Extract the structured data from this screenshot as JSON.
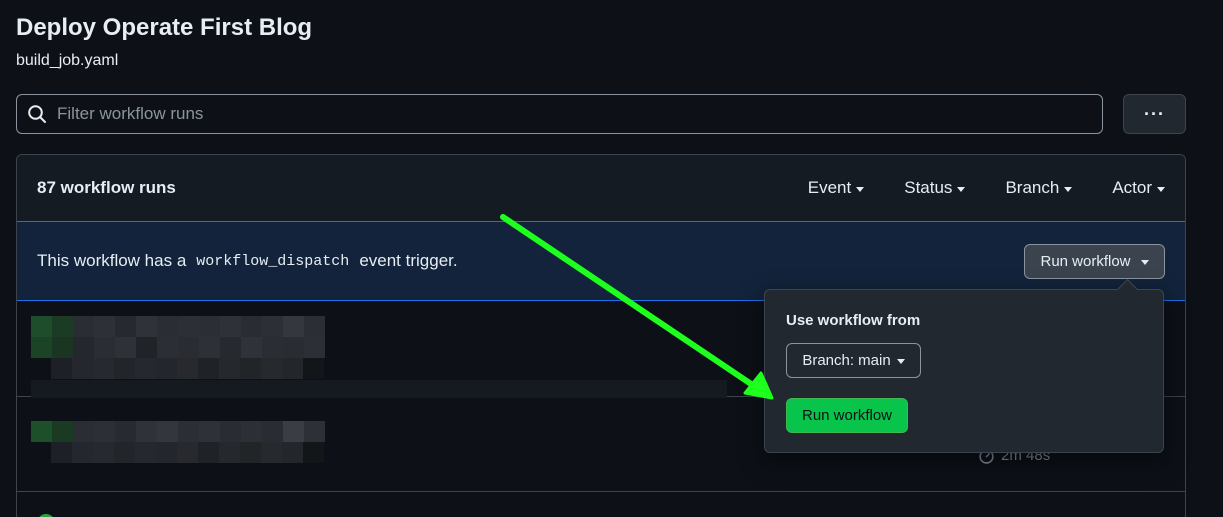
{
  "header": {
    "title": "Deploy Operate First Blog",
    "subtitle": "build_job.yaml"
  },
  "search": {
    "placeholder": "Filter workflow runs",
    "value": ""
  },
  "more_button": {
    "label": "···"
  },
  "runs": {
    "count_label": "87 workflow runs",
    "filters": [
      "Event",
      "Status",
      "Branch",
      "Actor"
    ]
  },
  "banner": {
    "prefix": "This workflow has a",
    "code": "workflow_dispatch",
    "suffix": "event trigger.",
    "button_label": "Run workflow"
  },
  "popover": {
    "title": "Use workflow from",
    "branch_label": "Branch: main",
    "run_label": "Run workflow"
  },
  "run_rows": [
    {
      "duration": ""
    },
    {
      "duration": "2m 48s"
    }
  ],
  "colors": {
    "background": "#0d1117",
    "banner": "#12233b",
    "run_button": "#09c44a",
    "annotation_arrow": "#1dff1d"
  }
}
